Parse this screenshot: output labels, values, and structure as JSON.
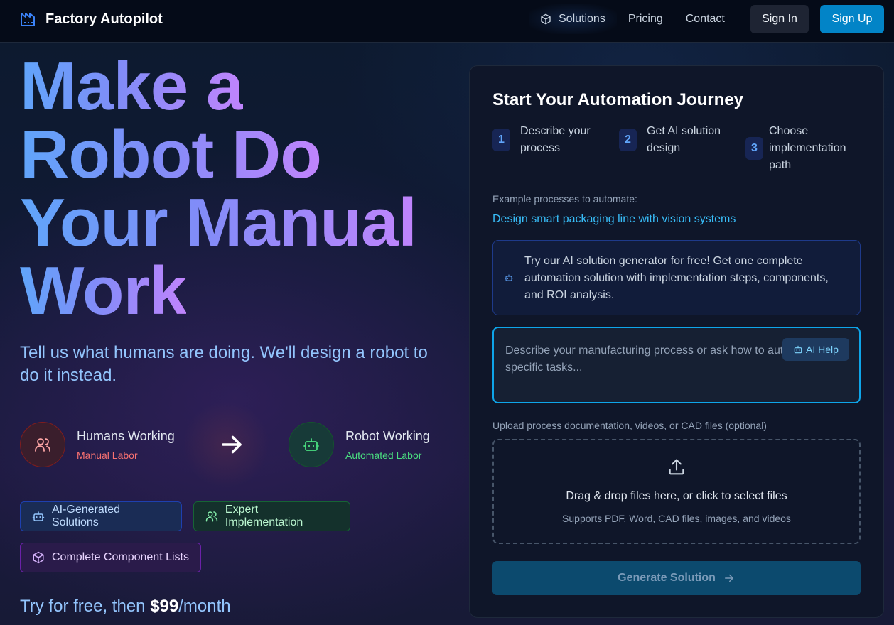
{
  "nav": {
    "brand": "Factory Autopilot",
    "links": [
      {
        "label": "Solutions",
        "icon": "cube-icon"
      },
      {
        "label": "Pricing"
      },
      {
        "label": "Contact"
      }
    ],
    "sign_in": "Sign In",
    "sign_up": "Sign Up"
  },
  "hero": {
    "title_lines": [
      "Make a",
      "Robot Do",
      "Your Manual",
      "Work"
    ],
    "subtitle": "Tell us what humans are doing. We'll design a robot to do it instead.",
    "humans": {
      "label": "Humans Working",
      "sub": "Manual Labor",
      "sub_color": "#f87171"
    },
    "robot": {
      "label": "Robot Working",
      "sub": "Automated Labor",
      "sub_color": "#4ade80"
    },
    "badges": [
      {
        "label": "AI-Generated Solutions",
        "icon": "bot-icon"
      },
      {
        "label": "Expert Implementation",
        "icon": "users-icon"
      },
      {
        "label": "Complete Component Lists",
        "icon": "cube-icon"
      }
    ],
    "pricing": {
      "prefix": "Try for free, then ",
      "price": "$99",
      "suffix": "/month"
    }
  },
  "card": {
    "title": "Start Your Automation Journey",
    "steps": [
      {
        "num": "1",
        "text_lines": [
          "Describe your",
          "process"
        ]
      },
      {
        "num": "2",
        "text_lines": [
          "Get AI solution",
          "design"
        ]
      },
      {
        "num": "3",
        "text_lines": [
          "Choose",
          "implementation",
          "path"
        ]
      }
    ],
    "examples_label": "Example processes to automate:",
    "example": "Design smart packaging line with vision systems",
    "info": "Try our AI solution generator for free! Get one complete automation solution with implementation steps, components, and ROI analysis.",
    "textarea_placeholder": "Describe your manufacturing process or ask how to automate specific tasks...",
    "ai_help": "AI Help",
    "upload_label": "Upload process documentation, videos, or CAD files (optional)",
    "drop_main": "Drag & drop files here, or click to select files",
    "drop_sub": "Supports PDF, Word, CAD files, images, and videos",
    "generate": "Generate Solution"
  }
}
